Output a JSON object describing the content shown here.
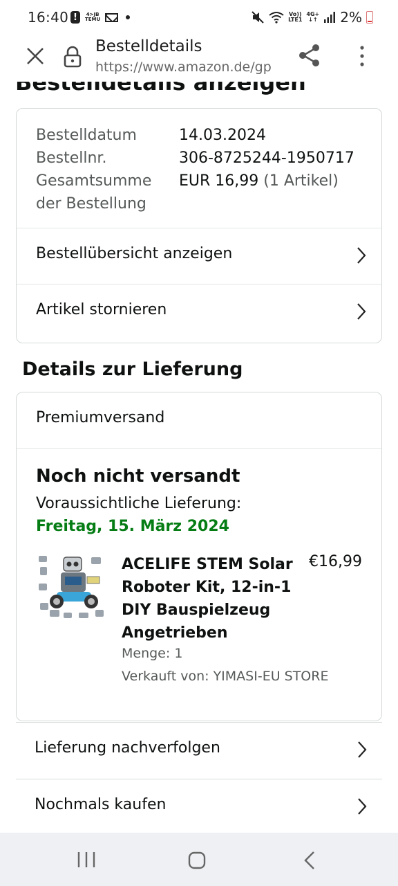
{
  "status_bar": {
    "time": "16:40",
    "notification_icons": [
      "alert-icon",
      "temu-icon",
      "mail-icon",
      "dot-icon"
    ],
    "temu_top": "4>JB",
    "temu_bottom": "TEMU",
    "volte_top": "Vo))",
    "volte_bottom": "LTE1",
    "network": "4G+",
    "battery": "2%"
  },
  "browser": {
    "title": "Bestelldetails",
    "url": "https://www.amazon.de/gp"
  },
  "page": {
    "heading": "Bestelldetails anzeigen",
    "order_info": {
      "date_label": "Bestelldatum",
      "date_value": "14.03.2024",
      "number_label": "Bestellnr.",
      "number_value": "306-8725244-1950717",
      "total_label_1": "Gesamtsumme",
      "total_label_2": "der Bestellung",
      "total_value": "EUR 16,99",
      "total_items": "(1 Artikel)"
    },
    "links": {
      "overview": "Bestellübersicht anzeigen",
      "cancel": "Artikel stornieren"
    },
    "delivery": {
      "section_title": "Details zur Lieferung",
      "shipping_type": "Premiumversand",
      "status": "Noch nicht versandt",
      "expected_label": "Voraussichtliche Lieferung:",
      "expected_date": "Freitag, 15. März 2024",
      "product": {
        "title": "ACELIFE STEM Solar Roboter Kit, 12-in-1 DIY Bauspielzeug Angetrieben",
        "price": "€16,99",
        "quantity": "Menge: 1",
        "seller": "Verkauft von: YIMASI-EU STORE"
      },
      "track": "Lieferung nachverfolgen",
      "buy_again": "Nochmals kaufen"
    }
  },
  "colors": {
    "delivery_date_green": "#067d14",
    "border": "#d5d9d9",
    "muted_text": "#565959",
    "nav_bar_bg": "#eef0f4"
  }
}
